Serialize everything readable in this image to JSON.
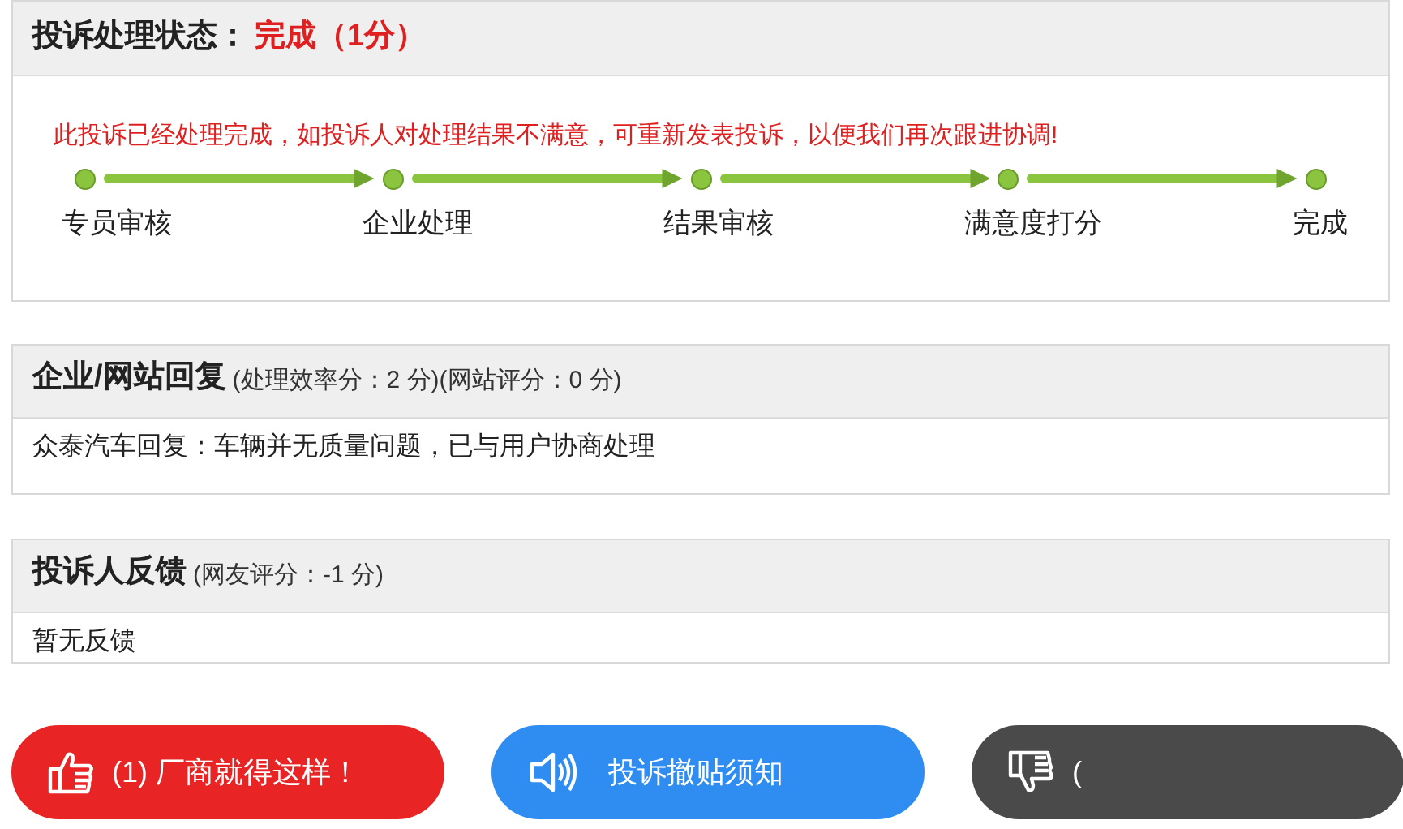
{
  "status_panel": {
    "title": "投诉处理状态：",
    "status": "完成（1分）",
    "notice": "此投诉已经处理完成，如投诉人对处理结果不满意，可重新发表投诉，以便我们再次跟进协调!",
    "steps": [
      {
        "label": "专员审核"
      },
      {
        "label": "企业处理"
      },
      {
        "label": "结果审核"
      },
      {
        "label": "满意度打分"
      },
      {
        "label": "完成"
      }
    ]
  },
  "reply_panel": {
    "title": "企业/网站回复",
    "note": "(处理效率分：2 分)(网站评分：0 分)",
    "body": "众泰汽车回复：车辆并无质量问题，已与用户协商处理"
  },
  "feedback_panel": {
    "title": "投诉人反馈",
    "note": "(网友评分：-1 分)",
    "body": "暂无反馈"
  },
  "buttons": [
    {
      "kind": "like",
      "label": "(1) 厂商就得这样！"
    },
    {
      "kind": "notice",
      "label": "投诉撤贴须知"
    },
    {
      "kind": "dislike",
      "label": "("
    }
  ]
}
